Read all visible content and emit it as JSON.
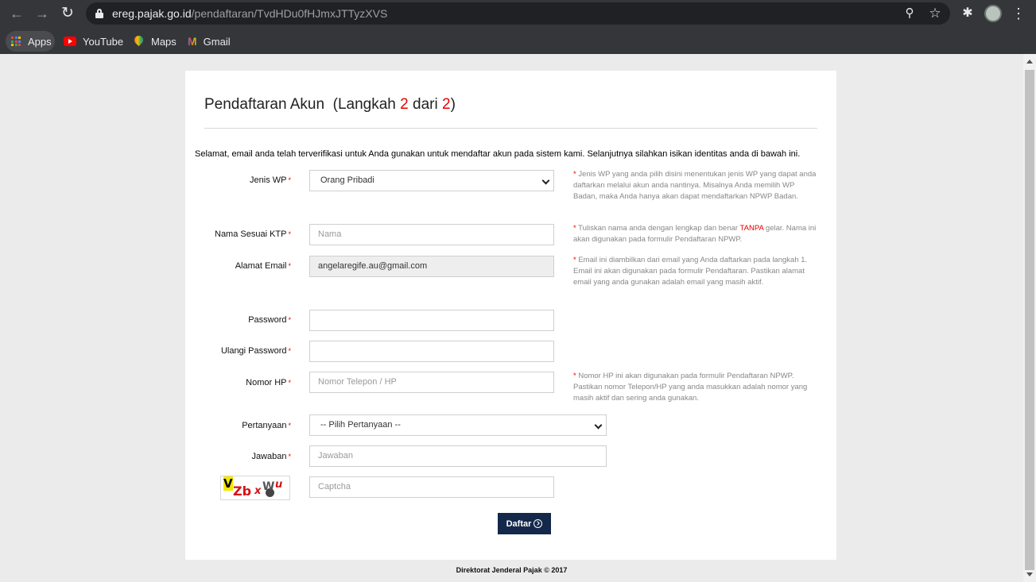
{
  "browser": {
    "url_host": "ereg.pajak.go.id",
    "url_path": "/pendaftaran/TvdHDu0fHJmxJTTyzXVS",
    "bookmarks": [
      "Apps",
      "YouTube",
      "Maps",
      "Gmail"
    ]
  },
  "page": {
    "title_main": "Pendaftaran Akun",
    "title_step_pre": "(Langkah ",
    "title_step_current": "2",
    "title_step_mid": " dari ",
    "title_step_total": "2",
    "title_step_post": ")",
    "intro": "Selamat, email anda telah terverifikasi untuk Anda gunakan untuk mendaftar akun pada sistem kami. Selanjutnya silahkan isikan identitas anda di bawah ini.",
    "required_mark": "*"
  },
  "form": {
    "jenis_wp": {
      "label": "Jenis WP",
      "value": "Orang Pribadi"
    },
    "nama": {
      "label": "Nama Sesuai KTP",
      "placeholder": "Nama"
    },
    "email": {
      "label": "Alamat Email",
      "value": "angelaregife.au@gmail.com"
    },
    "password": {
      "label": "Password",
      "value": ""
    },
    "ulangi_password": {
      "label": "Ulangi Password",
      "value": ""
    },
    "nomor_hp": {
      "label": "Nomor HP",
      "placeholder": "Nomor Telepon / HP"
    },
    "pertanyaan": {
      "label": "Pertanyaan",
      "value": "-- Pilih Pertanyaan --"
    },
    "jawaban": {
      "label": "Jawaban",
      "placeholder": "Jawaban"
    },
    "captcha": {
      "placeholder": "Captcha",
      "image_text": [
        "V",
        "Zb",
        "x",
        "W",
        "u"
      ]
    },
    "submit_label": "Daftar"
  },
  "notes": {
    "jenis_wp": "Jenis WP yang anda pilih disini menentukan jenis WP yang dapat anda daftarkan melalui akun anda nantinya. Misalnya Anda memilih WP Badan, maka Anda hanya akan dapat mendaftarkan NPWP Badan.",
    "nama_pre": "Tuliskan nama anda dengan lengkap dan benar ",
    "nama_red": "TANPA",
    "nama_post": " gelar. Nama ini akan digunakan pada formulir Pendaftaran NPWP.",
    "email": "Email ini diambilkan dari email yang Anda daftarkan pada langkah 1. Email ini akan digunakan pada formulir Pendaftaran. Pastikan alamat email yang anda gunakan adalah email yang masih aktif.",
    "nomor_hp": "Nomor HP ini akan digunakan pada formulir Pendaftaran NPWP. Pastikan nomor Telepon/HP yang anda masukkan adalah nomor yang masih aktif dan sering anda gunakan."
  },
  "footer": "Direktorat Jenderal Pajak © 2017",
  "colors": {
    "required_red": "#e50000",
    "button_navy": "#14284b",
    "chrome_dark": "#35363a"
  }
}
